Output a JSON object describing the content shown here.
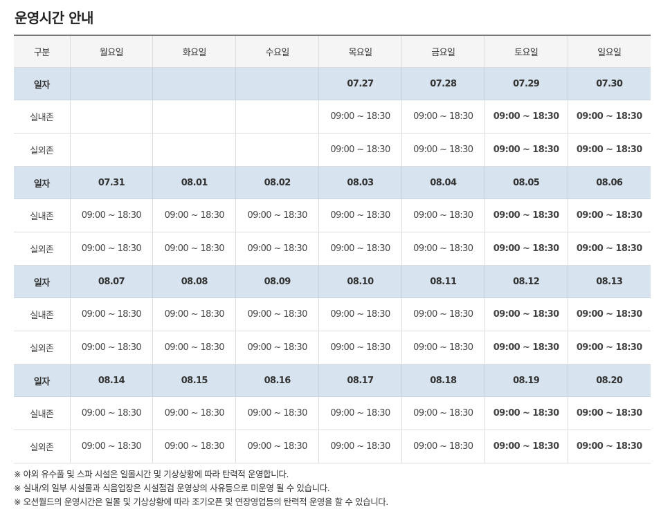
{
  "title": "운영시간 안내",
  "colors": {
    "saturday": "#1a5fc4",
    "sunday": "#d22b1e",
    "date_row_bg": "#d7e3ee"
  },
  "header": [
    "구분",
    "월요일",
    "화요일",
    "수요일",
    "목요일",
    "금요일",
    "토요일",
    "일요일"
  ],
  "weeks": [
    {
      "date_label": "일자",
      "dates": [
        "",
        "",
        "",
        "07.27",
        "07.28",
        "07.29",
        "07.30"
      ],
      "zones": [
        {
          "label": "실내존",
          "times": [
            "",
            "",
            "",
            "09:00 ~ 18:30",
            "09:00 ~ 18:30",
            "09:00 ~ 18:30",
            "09:00 ~ 18:30"
          ]
        },
        {
          "label": "실외존",
          "times": [
            "",
            "",
            "",
            "09:00 ~ 18:30",
            "09:00 ~ 18:30",
            "09:00 ~ 18:30",
            "09:00 ~ 18:30"
          ]
        }
      ]
    },
    {
      "date_label": "일자",
      "dates": [
        "07.31",
        "08.01",
        "08.02",
        "08.03",
        "08.04",
        "08.05",
        "08.06"
      ],
      "zones": [
        {
          "label": "실내존",
          "times": [
            "09:00 ~ 18:30",
            "09:00 ~ 18:30",
            "09:00 ~ 18:30",
            "09:00 ~ 18:30",
            "09:00 ~ 18:30",
            "09:00 ~ 18:30",
            "09:00 ~ 18:30"
          ]
        },
        {
          "label": "실외존",
          "times": [
            "09:00 ~ 18:30",
            "09:00 ~ 18:30",
            "09:00 ~ 18:30",
            "09:00 ~ 18:30",
            "09:00 ~ 18:30",
            "09:00 ~ 18:30",
            "09:00 ~ 18:30"
          ]
        }
      ]
    },
    {
      "date_label": "일자",
      "dates": [
        "08.07",
        "08.08",
        "08.09",
        "08.10",
        "08.11",
        "08.12",
        "08.13"
      ],
      "zones": [
        {
          "label": "실내존",
          "times": [
            "09:00 ~ 18:30",
            "09:00 ~ 18:30",
            "09:00 ~ 18:30",
            "09:00 ~ 18:30",
            "09:00 ~ 18:30",
            "09:00 ~ 18:30",
            "09:00 ~ 18:30"
          ]
        },
        {
          "label": "실외존",
          "times": [
            "09:00 ~ 18:30",
            "09:00 ~ 18:30",
            "09:00 ~ 18:30",
            "09:00 ~ 18:30",
            "09:00 ~ 18:30",
            "09:00 ~ 18:30",
            "09:00 ~ 18:30"
          ]
        }
      ]
    },
    {
      "date_label": "일자",
      "dates": [
        "08.14",
        "08.15",
        "08.16",
        "08.17",
        "08.18",
        "08.19",
        "08.20"
      ],
      "zones": [
        {
          "label": "실내존",
          "times": [
            "09:00 ~ 18:30",
            "09:00 ~ 18:30",
            "09:00 ~ 18:30",
            "09:00 ~ 18:30",
            "09:00 ~ 18:30",
            "09:00 ~ 18:30",
            "09:00 ~ 18:30"
          ]
        },
        {
          "label": "실외존",
          "times": [
            "09:00 ~ 18:30",
            "09:00 ~ 18:30",
            "09:00 ~ 18:30",
            "09:00 ~ 18:30",
            "09:00 ~ 18:30",
            "09:00 ~ 18:30",
            "09:00 ~ 18:30"
          ]
        }
      ]
    }
  ],
  "notes": [
    "※ 야외 유수풀 및 스파 시설은 일몰시간 및 기상상황에 따라 탄력적 운영합니다.",
    "※ 실내/외 일부 시설물과 식음업장은 시설점검 운영상의 사유등으로 미운영 될 수 있습니다.",
    "※ 오션월드의 운영시간은 일몰 및 기상상황에 따라 조기오픈 및 연장영업등의 탄력적 운영을 할 수 있습니다."
  ]
}
